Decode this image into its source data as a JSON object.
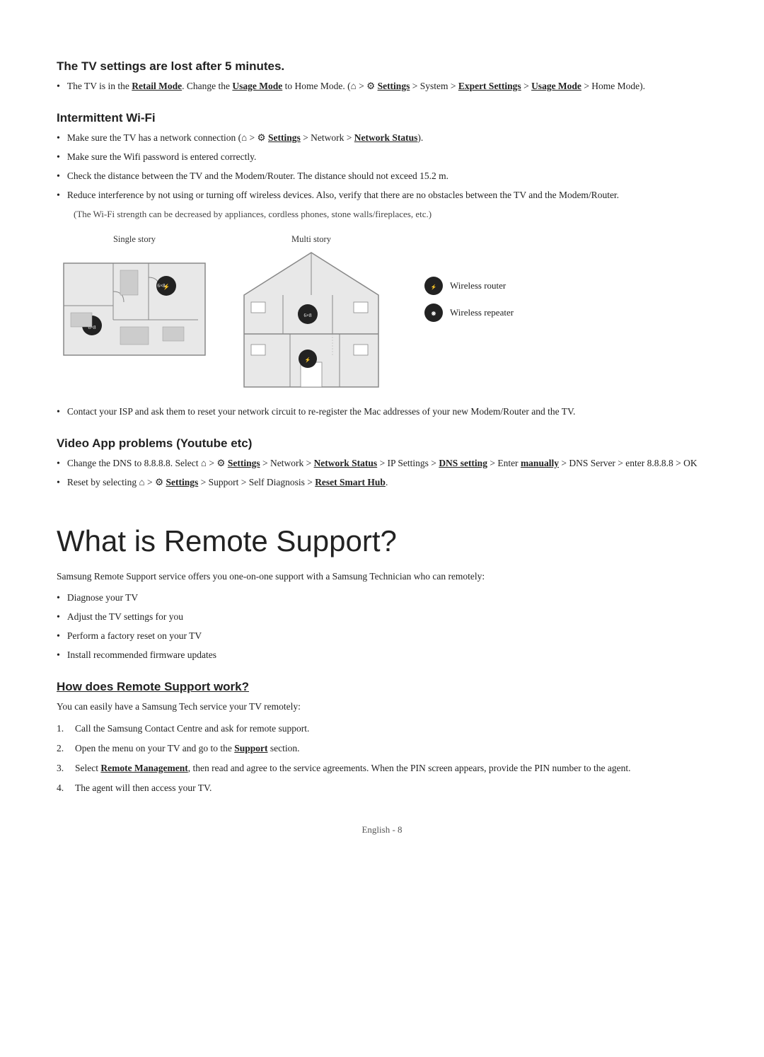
{
  "sections": {
    "tv_settings": {
      "title": "The TV settings are lost after 5 minutes.",
      "bullet1": "The TV is in the ",
      "bullet1_bold1": "Retail Mode",
      "bullet1_mid": ". Change the ",
      "bullet1_bold2": "Usage Mode",
      "bullet1_mid2": " to Home Mode. (",
      "bullet1_mid3": " > ",
      "bullet1_bold3": "Settings",
      "bullet1_mid4": " > System > ",
      "bullet1_bold4": "Expert Settings",
      "bullet1_mid5": " > ",
      "bullet1_bold5": "Usage Mode",
      "bullet1_mid6": " > Home Mode)."
    },
    "wifi": {
      "title": "Intermittent Wi-Fi",
      "bullet1_pre": "Make sure the TV has a network connection (",
      "bullet1_mid": " > ",
      "bullet1_bold": "Settings",
      "bullet1_suf": " > Network > ",
      "bullet1_bold2": "Network Status",
      "bullet1_end": ").",
      "bullet2": "Make sure the Wifi password is entered correctly.",
      "bullet3": "Check the distance between the TV and the Modem/Router. The distance should not exceed 15.2 m.",
      "bullet4": "Reduce interference by not using or turning off wireless devices. Also, verify that there are no obstacles between the TV and the Modem/Router.",
      "note": "(The Wi-Fi strength can be decreased by appliances, cordless phones, stone walls/fireplaces, etc.)",
      "diagram": {
        "single_label": "Single story",
        "multi_label": "Multi story",
        "legend_router": "Wireless router",
        "legend_repeater": "Wireless repeater"
      },
      "bullet5": "Contact your ISP and ask them to reset your network circuit to re-register the Mac addresses of your new Modem/Router and the TV."
    },
    "video_app": {
      "title": "Video App problems (Youtube etc)",
      "bullet1_pre": "Change the DNS to 8.8.8.8. Select ",
      "bullet1_mid": " > ",
      "bullet1_bold1": "Settings",
      "bullet1_mid2": " > Network > ",
      "bullet1_bold2": "Network Status",
      "bullet1_mid3": " > IP Settings > ",
      "bullet1_bold3": "DNS setting",
      "bullet1_mid4": " > Enter ",
      "bullet1_bold4": "manually",
      "bullet1_mid5": " > DNS Server > enter 8.8.8.8 > OK",
      "bullet2_pre": "Reset by selecting ",
      "bullet2_mid": " > ",
      "bullet2_bold1": "Settings",
      "bullet2_mid2": " > Support > Self Diagnosis > ",
      "bullet2_bold2": "Reset Smart Hub",
      "bullet2_end": "."
    },
    "remote_support": {
      "main_title": "What is Remote Support?",
      "intro": "Samsung Remote Support service offers you one-on-one support with a Samsung Technician who can remotely:",
      "bullet1": "Diagnose your TV",
      "bullet2": "Adjust the TV settings for you",
      "bullet3": "Perform a factory reset on your TV",
      "bullet4": "Install recommended firmware updates"
    },
    "how_works": {
      "title": "How does Remote Support work?",
      "intro": "You can easily have a Samsung Tech service your TV remotely:",
      "step1": "Call the Samsung Contact Centre and ask for remote support.",
      "step2_pre": "Open the menu on your TV and go to the ",
      "step2_bold": "Support",
      "step2_suf": " section.",
      "step3_pre": "Select ",
      "step3_bold": "Remote Management",
      "step3_mid": ", then read and agree to the service agreements. When the PIN screen appears, provide the PIN number to the agent.",
      "step4": "The agent will then access your TV."
    }
  },
  "footer": {
    "text": "English - 8"
  },
  "icons": {
    "home": "⌂",
    "settings": "⚙"
  }
}
